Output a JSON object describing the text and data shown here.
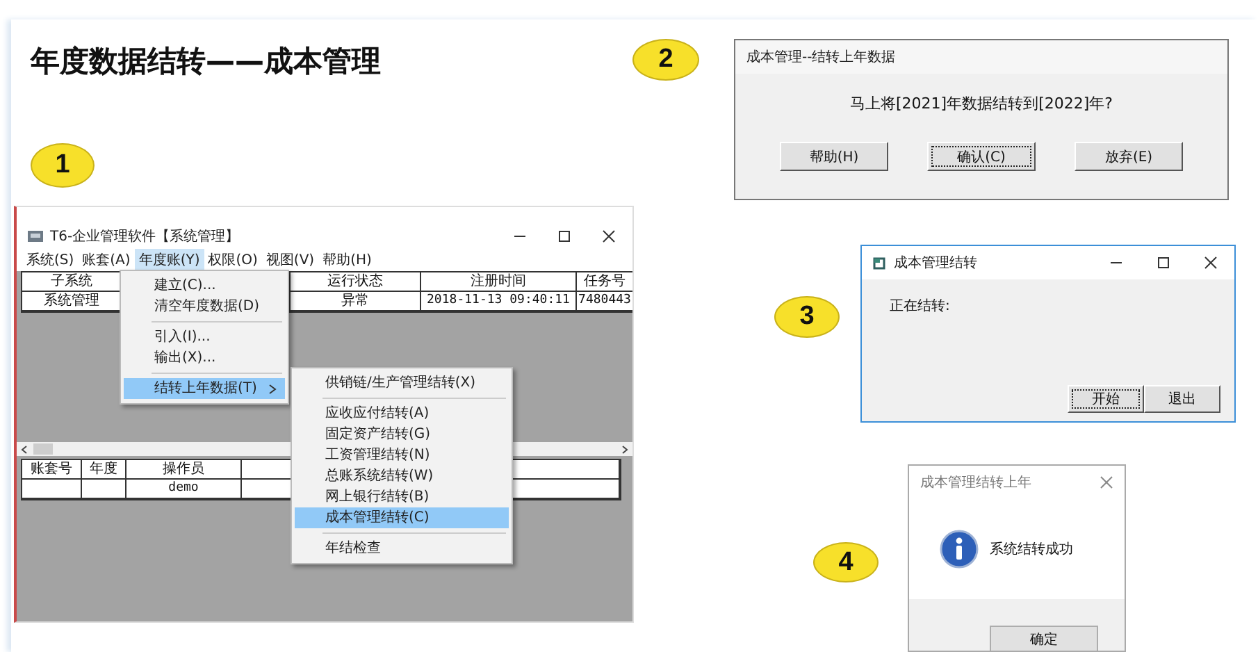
{
  "slide_title": "年度数据结转——成本管理",
  "step_1": {
    "badge": "1",
    "window": {
      "title": "T6-企业管理软件【系统管理】",
      "menu": [
        {
          "label": "系统(S)",
          "selected": false
        },
        {
          "label": "账套(A)",
          "selected": false
        },
        {
          "label": "年度账(Y)",
          "selected": true
        },
        {
          "label": "权限(O)",
          "selected": false
        },
        {
          "label": "视图(V)",
          "selected": false
        },
        {
          "label": "帮助(H)",
          "selected": false
        }
      ],
      "dropdown": [
        [
          {
            "label": "建立(C)...",
            "selected": false,
            "has_submenu": false
          },
          {
            "label": "清空年度数据(D)",
            "selected": false,
            "has_submenu": false
          }
        ],
        [
          {
            "label": "引入(I)...",
            "selected": false,
            "has_submenu": false
          },
          {
            "label": "输出(X)...",
            "selected": false,
            "has_submenu": false
          }
        ],
        [
          {
            "label": "结转上年数据(T)",
            "selected": true,
            "has_submenu": true
          }
        ]
      ],
      "submenu": [
        [
          {
            "label": "供销链/生产管理结转(X)",
            "selected": false
          }
        ],
        [
          {
            "label": "应收应付结转(A)",
            "selected": false
          },
          {
            "label": "固定资产结转(G)",
            "selected": false
          },
          {
            "label": "工资管理结转(N)",
            "selected": false
          },
          {
            "label": "总账系统结转(W)",
            "selected": false
          },
          {
            "label": "网上银行结转(B)",
            "selected": false
          },
          {
            "label": "成本管理结转(C)",
            "selected": true
          }
        ],
        [
          {
            "label": "年结检查",
            "selected": false
          }
        ]
      ],
      "table": [
        {
          "label": "子系统",
          "cell": "系统管理"
        },
        {
          "label": "运行状态",
          "cell": "异常"
        },
        {
          "label": "注册时间",
          "cell": "2018-11-13 09:40:11"
        },
        {
          "label": "任务号",
          "cell": "7480443"
        }
      ],
      "table_2": [
        {
          "label": "账套号"
        },
        {
          "label": "年度"
        },
        {
          "label": "操作员",
          "cell": "demo"
        }
      ]
    }
  },
  "step_2": {
    "badge": "2",
    "dialog": {
      "title": "成本管理--结转上年数据",
      "message": "马上将[2021]年数据结转到[2022]年?",
      "buttons": [
        {
          "label": "帮助(H)",
          "focused": false
        },
        {
          "label": "确认(C)",
          "focused": true
        },
        {
          "label": "放弃(E)",
          "focused": false
        }
      ]
    }
  },
  "step_3": {
    "badge": "3",
    "window": {
      "title": "成本管理结转",
      "status": "正在结转:",
      "buttons": [
        {
          "label": "开始",
          "focused": true
        },
        {
          "label": "退出",
          "focused": false
        }
      ]
    }
  },
  "step_4": {
    "badge": "4",
    "dialog": {
      "title": "成本管理结转上年",
      "message": "系统结转成功",
      "buttons": [
        {
          "label": "确定",
          "focused": false
        }
      ]
    }
  }
}
